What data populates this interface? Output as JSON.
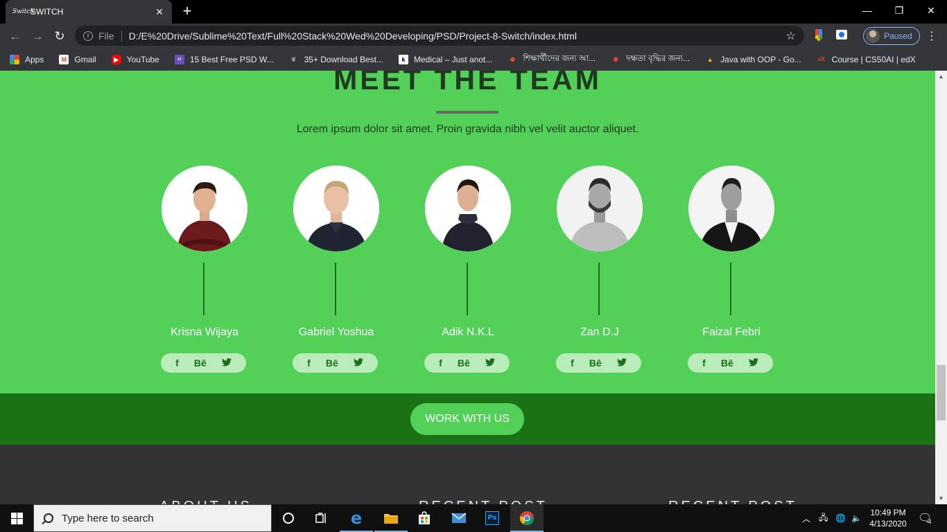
{
  "browser": {
    "tab_title": "SWITCH",
    "favicon_text": "Switch",
    "new_tab": "+",
    "url_scheme": "File",
    "url": "D:/E%20Drive/Sublime%20Text/Full%20Stack%20Wed%20Developing/PSD/Project-8-Switch/index.html",
    "profile_label": "Paused",
    "bookmarks": [
      {
        "label": "Apps",
        "icon": "apps-grid-icon"
      },
      {
        "label": "Gmail",
        "icon": "gmail-icon"
      },
      {
        "label": "YouTube",
        "icon": "youtube-icon"
      },
      {
        "label": "15 Best Free PSD W...",
        "icon": "colorlib-icon"
      },
      {
        "label": "35+ Download Best...",
        "icon": "leaf-icon"
      },
      {
        "label": "Medical – Just anot...",
        "icon": "k-icon"
      },
      {
        "label": "শিক্ষার্থীদের জন্য আ...",
        "icon": "flame-icon"
      },
      {
        "label": "দক্ষতা বৃদ্ধির জন্য...",
        "icon": "flame-icon"
      },
      {
        "label": "Java with OOP - Go...",
        "icon": "google-drive-icon"
      },
      {
        "label": "Course | CS50AI | edX",
        "icon": "edx-icon"
      }
    ]
  },
  "team": {
    "title": "MEET THE TEAM",
    "subtitle": "Lorem ipsum dolor sit amet. Proin gravida nibh vel velit auctor aliquet.",
    "members": [
      {
        "name": "Krisna Wijaya",
        "social": [
          "f",
          "Bē",
          "🐦"
        ]
      },
      {
        "name": "Gabriel Yoshua",
        "social": [
          "f",
          "Bē",
          "🐦"
        ]
      },
      {
        "name": "Adik N.K.L",
        "social": [
          "f",
          "Bē",
          "🐦"
        ]
      },
      {
        "name": "Zan D.J",
        "social": [
          "f",
          "Bē",
          "🐦"
        ]
      },
      {
        "name": "Faizal Febri",
        "social": [
          "f",
          "Bē",
          "🐦"
        ]
      }
    ]
  },
  "cta": {
    "label": "WORK WITH US"
  },
  "footer": {
    "headings": [
      "ABOUT US",
      "RECENT POST",
      "RECENT POST"
    ]
  },
  "taskbar": {
    "search_placeholder": "Type here to search",
    "time": "10:49 PM",
    "date": "4/13/2020",
    "notification_count": "4"
  },
  "colors": {
    "team_bg": "#52d058",
    "cta_band": "#1b7214",
    "footer_bg": "#333335"
  }
}
